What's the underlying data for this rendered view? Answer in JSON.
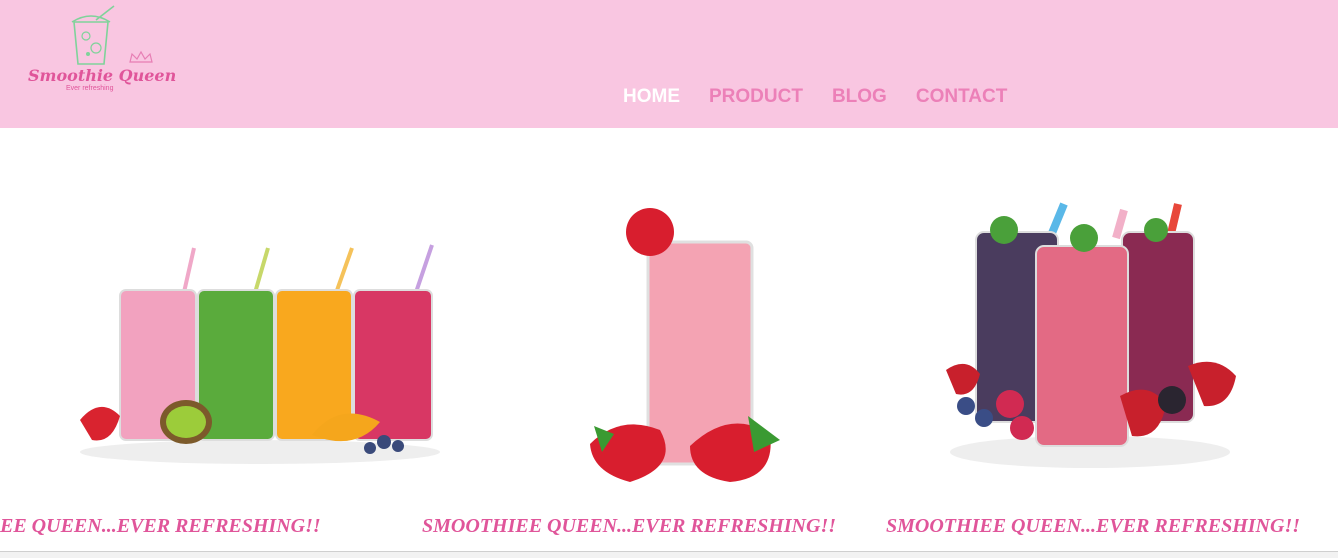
{
  "brand": {
    "name": "Smoothie Queen",
    "tagline": "Ever refreshing",
    "colors": {
      "header_bg": "#f9c6e1",
      "accent": "#e0559a",
      "nav": "#ec80b8",
      "nav_active": "#ffffff"
    }
  },
  "nav": {
    "items": [
      {
        "label": "HOME",
        "active": true
      },
      {
        "label": "PRODUCT",
        "active": false
      },
      {
        "label": "BLOG",
        "active": false
      },
      {
        "label": "CONTACT",
        "active": false
      }
    ]
  },
  "slides": [
    {
      "caption": "EE QUEEN...EVER REFRESHING!!",
      "image": "four-smoothie-glasses-with-straws"
    },
    {
      "caption": "SMOOTHIEE QUEEN...EVER REFRESHING!!",
      "image": "strawberry-smoothie-glass"
    },
    {
      "caption": "SMOOTHIEE QUEEN...EVER REFRESHING!!",
      "image": "berry-smoothies-with-fruit"
    }
  ]
}
